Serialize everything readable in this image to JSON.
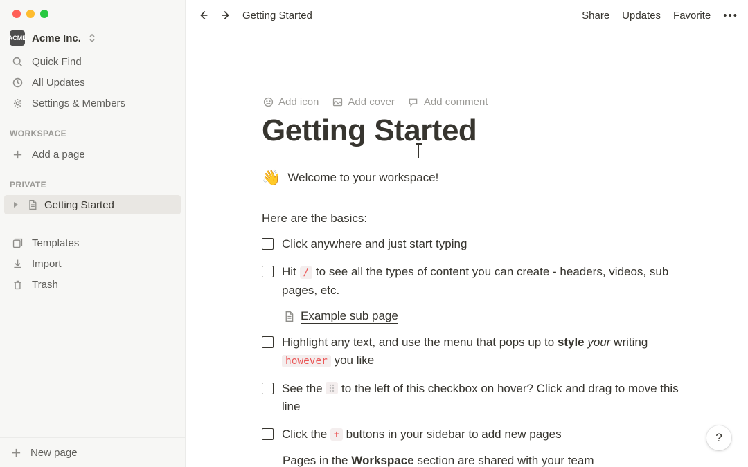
{
  "workspace": {
    "badge": "ACME",
    "name": "Acme Inc."
  },
  "sidebar": {
    "nav": [
      {
        "label": "Quick Find"
      },
      {
        "label": "All Updates"
      },
      {
        "label": "Settings & Members"
      }
    ],
    "section_workspace": "WORKSPACE",
    "add_page": "Add a page",
    "section_private": "PRIVATE",
    "private_pages": [
      {
        "label": "Getting Started"
      }
    ],
    "lower": [
      {
        "label": "Templates"
      },
      {
        "label": "Import"
      },
      {
        "label": "Trash"
      }
    ],
    "new_page": "New page"
  },
  "topbar": {
    "breadcrumb": "Getting Started",
    "share": "Share",
    "updates": "Updates",
    "favorite": "Favorite"
  },
  "actions": {
    "add_icon": "Add icon",
    "add_cover": "Add cover",
    "add_comment": "Add comment"
  },
  "page_title": "Getting Started",
  "welcome": {
    "emoji": "👋",
    "text": "Welcome to your workspace!"
  },
  "basics_heading": "Here are the basics:",
  "todos": {
    "item1": "Click anywhere and just start typing",
    "item2_pre": "Hit ",
    "item2_code": "/",
    "item2_post": " to see all the types of content you can create - headers, videos, sub pages, etc.",
    "subpage": "Example sub page",
    "item3_pre": "Highlight any text, and use the menu that pops up to ",
    "item3_bold": "style",
    "item3_italic": "your",
    "item3_strike": "writing",
    "item3_code": "however",
    "item3_under": "you",
    "item3_end": " like",
    "item4_pre": "See the ",
    "item4_post": " to the left of this checkbox on hover? Click and drag to move this line",
    "item5_pre": "Click the ",
    "item5_plus": "+",
    "item5_post": " buttons in your sidebar to add new pages",
    "cut_pre": "Pages in the ",
    "cut_bold": "Workspace",
    "cut_post": " section are shared with your team"
  },
  "help": "?"
}
